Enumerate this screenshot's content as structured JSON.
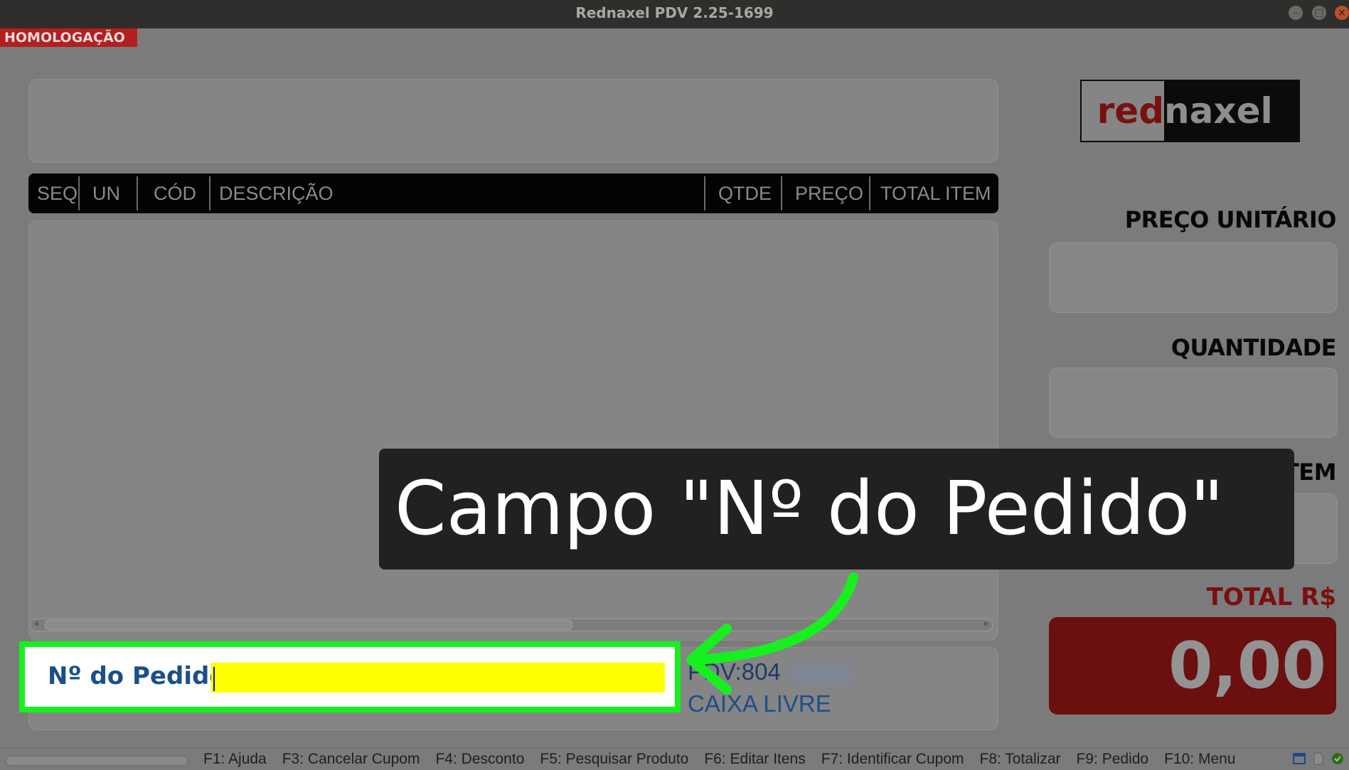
{
  "window": {
    "title": "Rednaxel PDV 2.25-1699",
    "controls": {
      "minimize": "–",
      "maximize": "□",
      "close": "×"
    }
  },
  "environment_badge": "HOMOLOGAÇÃO",
  "logo": {
    "part1": "red",
    "part2": "naxel"
  },
  "items_table": {
    "columns": [
      "SEQ",
      "UN",
      "CÓD",
      "DESCRIÇÃO",
      "QTDE",
      "PREÇO",
      "TOTAL ITEM"
    ],
    "rows": []
  },
  "right_panel": {
    "preco_unitario_label": "PREÇO UNITÁRIO",
    "preco_unitario_value": "",
    "quantidade_label": "QUANTIDADE",
    "quantidade_value": "",
    "total_item_label": "TOTAL DO ITEM",
    "total_item_value": "",
    "total_label": "TOTAL R$",
    "total_value": "0,00"
  },
  "order_field": {
    "label": "Nº do Pedido:",
    "value": ""
  },
  "pdv_info": {
    "pdv": "PDV:804",
    "status": "CAIXA LIVRE"
  },
  "annotation": {
    "callout_text": "Campo \"Nº do Pedido\""
  },
  "status_bar": {
    "shortcuts": [
      "F1: Ajuda",
      "F3: Cancelar Cupom",
      "F4: Desconto",
      "F5: Pesquisar Produto",
      "F6: Editar Itens",
      "F7: Identificar Cupom",
      "F8: Totalizar",
      "F9: Pedido",
      "F10: Menu"
    ]
  },
  "colors": {
    "highlight_frame": "#17f01f",
    "input_highlight": "#ffff00",
    "total_box": "#6b0f0f",
    "badge": "#b21f1f"
  }
}
